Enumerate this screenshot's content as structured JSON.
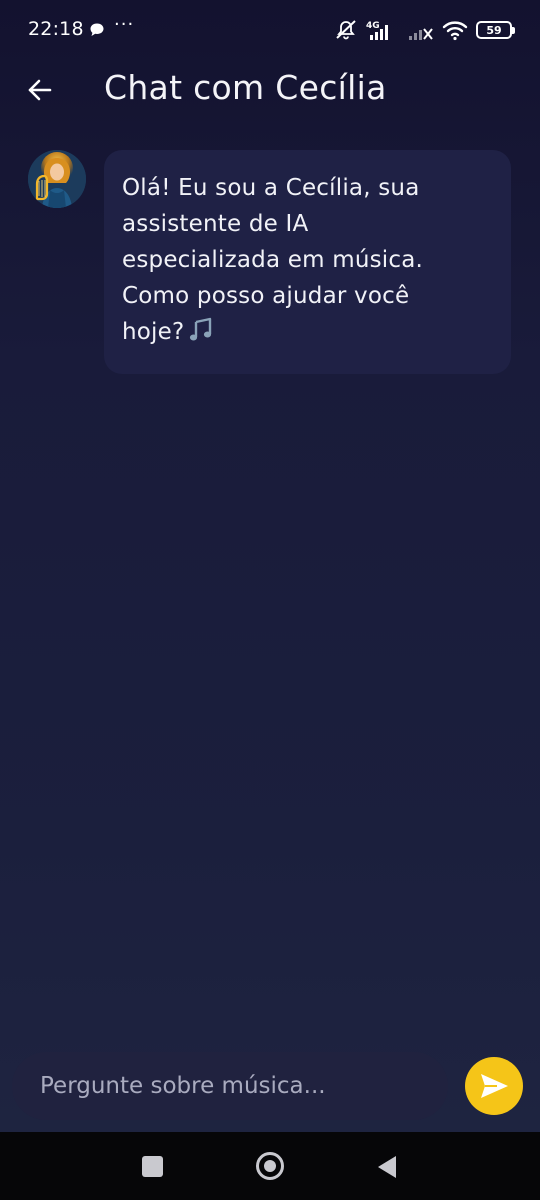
{
  "status_bar": {
    "time": "22:18",
    "icons": [
      "chat-bubble-icon",
      "more-dots-icon",
      "mute-icon",
      "4g-signal-icon",
      "signal-off-icon",
      "wifi-icon"
    ],
    "network": "4G",
    "battery": "59"
  },
  "header": {
    "title": "Chat com Cecília",
    "back_icon": "arrow-left-icon"
  },
  "messages": [
    {
      "sender": "Cecília",
      "avatar_icon": "angel-harp-avatar",
      "text": "Olá! Eu sou a Cecília, sua\nassistente de IA\nespecializada em música.\nComo posso ajudar você\nhoje?",
      "emoji_icon": "music-note-icon"
    }
  ],
  "composer": {
    "placeholder": "Pergunte sobre música...",
    "value": "",
    "send_icon": "send-icon"
  },
  "colors": {
    "accent": "#f5c518",
    "bubble": "#1f2145",
    "background_top": "#13122f",
    "background_bottom": "#1f2541"
  },
  "nav_bar": {
    "icons": [
      "recents-square-icon",
      "home-circle-icon",
      "back-triangle-icon"
    ]
  }
}
